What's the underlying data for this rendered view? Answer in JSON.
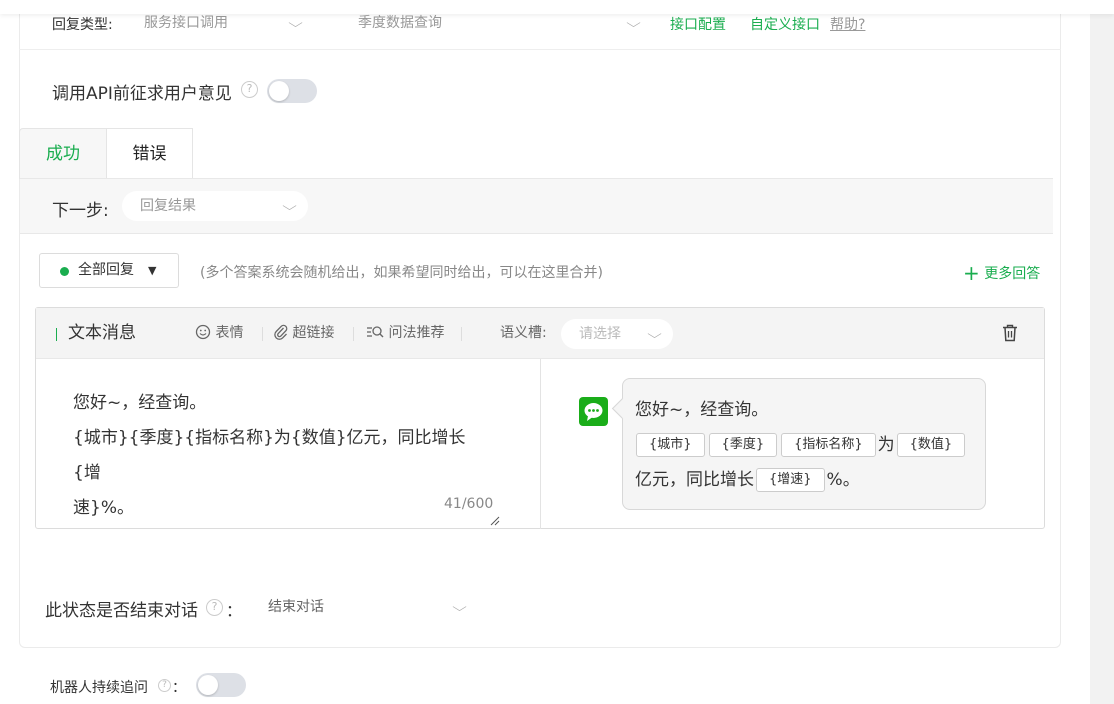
{
  "header": {
    "reply_type_label": "回复类型:",
    "reply_type_value": "服务接口调用",
    "query_value": "季度数据查询",
    "api_config_link": "接口配置",
    "custom_api_link": "自定义接口",
    "help_link": "帮助?"
  },
  "consent": {
    "label": "调用API前征求用户意见",
    "help": "?",
    "enabled": false
  },
  "tabs": [
    {
      "label": "成功",
      "active": true
    },
    {
      "label": "错误",
      "active": false
    }
  ],
  "next_step": {
    "label": "下一步:",
    "value": "回复结果"
  },
  "reply_mode": {
    "button_label": "全部回复",
    "hint": "(多个答案系统会随机给出，如果希望同时给出，可以在这里合并)",
    "more_answers": "更多回答"
  },
  "editor": {
    "title": "文本消息",
    "tools": [
      "表情",
      "超链接",
      "问法推荐"
    ],
    "slot_label": "语义槽:",
    "slot_placeholder": "请选择",
    "lines": [
      "您好~，经查询。",
      "{城市}{季度}{指标名称}为{数值}亿元，同比增长{增",
      "速}%。"
    ],
    "counter": "41/600"
  },
  "preview": {
    "line1": "您好~，经查询。",
    "chip1": "{城市}",
    "chip2": "{季度}",
    "chip3": "{指标名称}",
    "text_wei": "为",
    "chip4": "{数值}",
    "text_yiyuan": "亿元，同比增长",
    "chip5": "{增速}",
    "text_percent": "%。"
  },
  "end_state": {
    "label": "此状态是否结束对话",
    "help": "?",
    "colon": "：",
    "value": "结束对话"
  },
  "followup": {
    "label": "机器人持续追问",
    "help": "?",
    "colon": "：",
    "enabled": false
  },
  "colors": {
    "accent": "#1aad4f",
    "wechat_green": "#1aad19"
  }
}
